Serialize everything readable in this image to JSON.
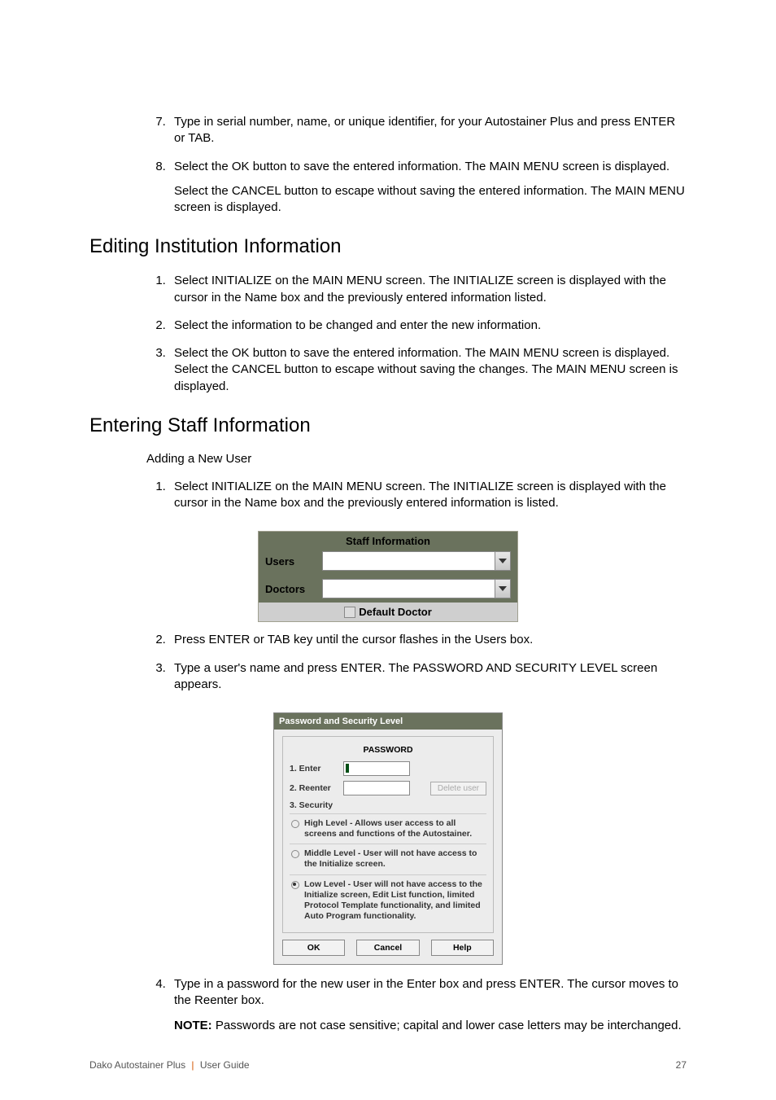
{
  "list7_8": [
    {
      "marker": "7.",
      "text": "Type in serial number, name, or unique identifier, for your Autostainer Plus and press ENTER or TAB."
    },
    {
      "marker": "8.",
      "text": "Select the OK button to save the entered information. The MAIN MENU screen is displayed.",
      "extra": "Select the CANCEL button to escape without saving the entered information. The MAIN MENU  screen is displayed."
    }
  ],
  "section_editing": "Editing Institution Information",
  "editing_list": [
    {
      "marker": "1.",
      "text": "Select INITIALIZE on the MAIN MENU screen. The INITIALIZE screen is displayed with the cursor in the Name box and the previously entered information listed."
    },
    {
      "marker": "2.",
      "text": "Select the information to be changed and enter the new information."
    },
    {
      "marker": "3.",
      "text": "Select the OK button to save the entered information. The MAIN MENU screen is displayed. Select the CANCEL button to escape without saving the changes. The MAIN MENU screen is displayed."
    }
  ],
  "section_entering": "Entering Staff Information",
  "subhead": "Adding a New User",
  "entering_list_1": [
    {
      "marker": "1.",
      "text": "Select INITIALIZE on the MAIN MENU screen. The INITIALIZE screen is displayed with the cursor in the Name box and the previously entered information is listed."
    }
  ],
  "staff": {
    "title": "Staff Information",
    "users": "Users",
    "doctors": "Doctors",
    "default_doctor": "Default Doctor"
  },
  "entering_list_2": [
    {
      "marker": "2.",
      "text": "Press ENTER or TAB key until the cursor flashes in the Users box."
    },
    {
      "marker": "3.",
      "text": "Type a user's name and press ENTER. The PASSWORD AND SECURITY LEVEL screen appears."
    }
  ],
  "pwd": {
    "title": "Password and Security Level",
    "section": "PASSWORD",
    "enter": "1. Enter",
    "reenter": "2. Reenter",
    "delete": "Delete user",
    "security": "3. Security",
    "opt_high": "High Level - Allows user access to all screens and functions of the Autostainer.",
    "opt_mid": "Middle Level - User will not have access to the Initialize screen.",
    "opt_low": "Low Level - User will not have access to the Initialize screen, Edit List function, limited Protocol Template functionality, and limited Auto Program functionality.",
    "ok": "OK",
    "cancel": "Cancel",
    "help": "Help"
  },
  "entering_list_4": [
    {
      "marker": "4.",
      "text": "Type in a password for the new user in the Enter box and press ENTER. The cursor moves to the Reenter box.",
      "note_label": "NOTE:",
      "note": "  Passwords are not case sensitive; capital and lower case letters may be interchanged."
    }
  ],
  "footer": {
    "product": "Dako Autostainer Plus",
    "guide": "User Guide",
    "page": "27"
  }
}
